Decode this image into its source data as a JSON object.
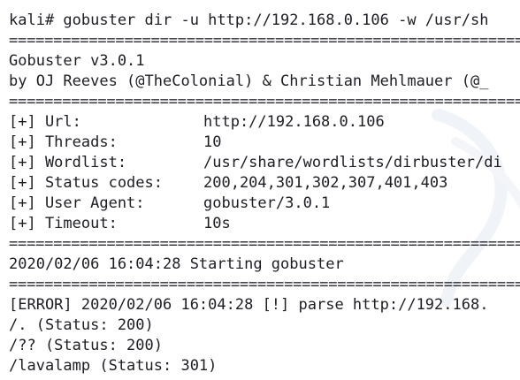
{
  "terminal": {
    "command_line": "kali# gobuster dir -u http://192.168.0.106 -w /usr/sh",
    "separator": "=====================================================================",
    "banner_version": "Gobuster v3.0.1",
    "banner_authors": "by OJ Reeves (@TheColonial) & Christian Mehlmauer (@_",
    "config": [
      {
        "key": "[+] Url:",
        "value": "http://192.168.0.106"
      },
      {
        "key": "[+] Threads:",
        "value": "10"
      },
      {
        "key": "[+] Wordlist:",
        "value": "/usr/share/wordlists/dirbuster/di"
      },
      {
        "key": "[+] Status codes:",
        "value": "200,204,301,302,307,401,403"
      },
      {
        "key": "[+] User Agent:",
        "value": "gobuster/3.0.1"
      },
      {
        "key": "[+] Timeout:",
        "value": "10s"
      }
    ],
    "start_line": "2020/02/06 16:04:28 Starting gobuster",
    "error_line": "[ERROR] 2020/02/06 16:04:28 [!] parse http://192.168.",
    "results": [
      "/. (Status: 200)",
      "/?? (Status: 200)",
      "/lavalamp (Status: 301)"
    ]
  },
  "colors": {
    "background": "#ffffff",
    "text": "#1d1d24",
    "watermark": "#eef2f7"
  },
  "watermark_icon": "kali-dragon-icon"
}
